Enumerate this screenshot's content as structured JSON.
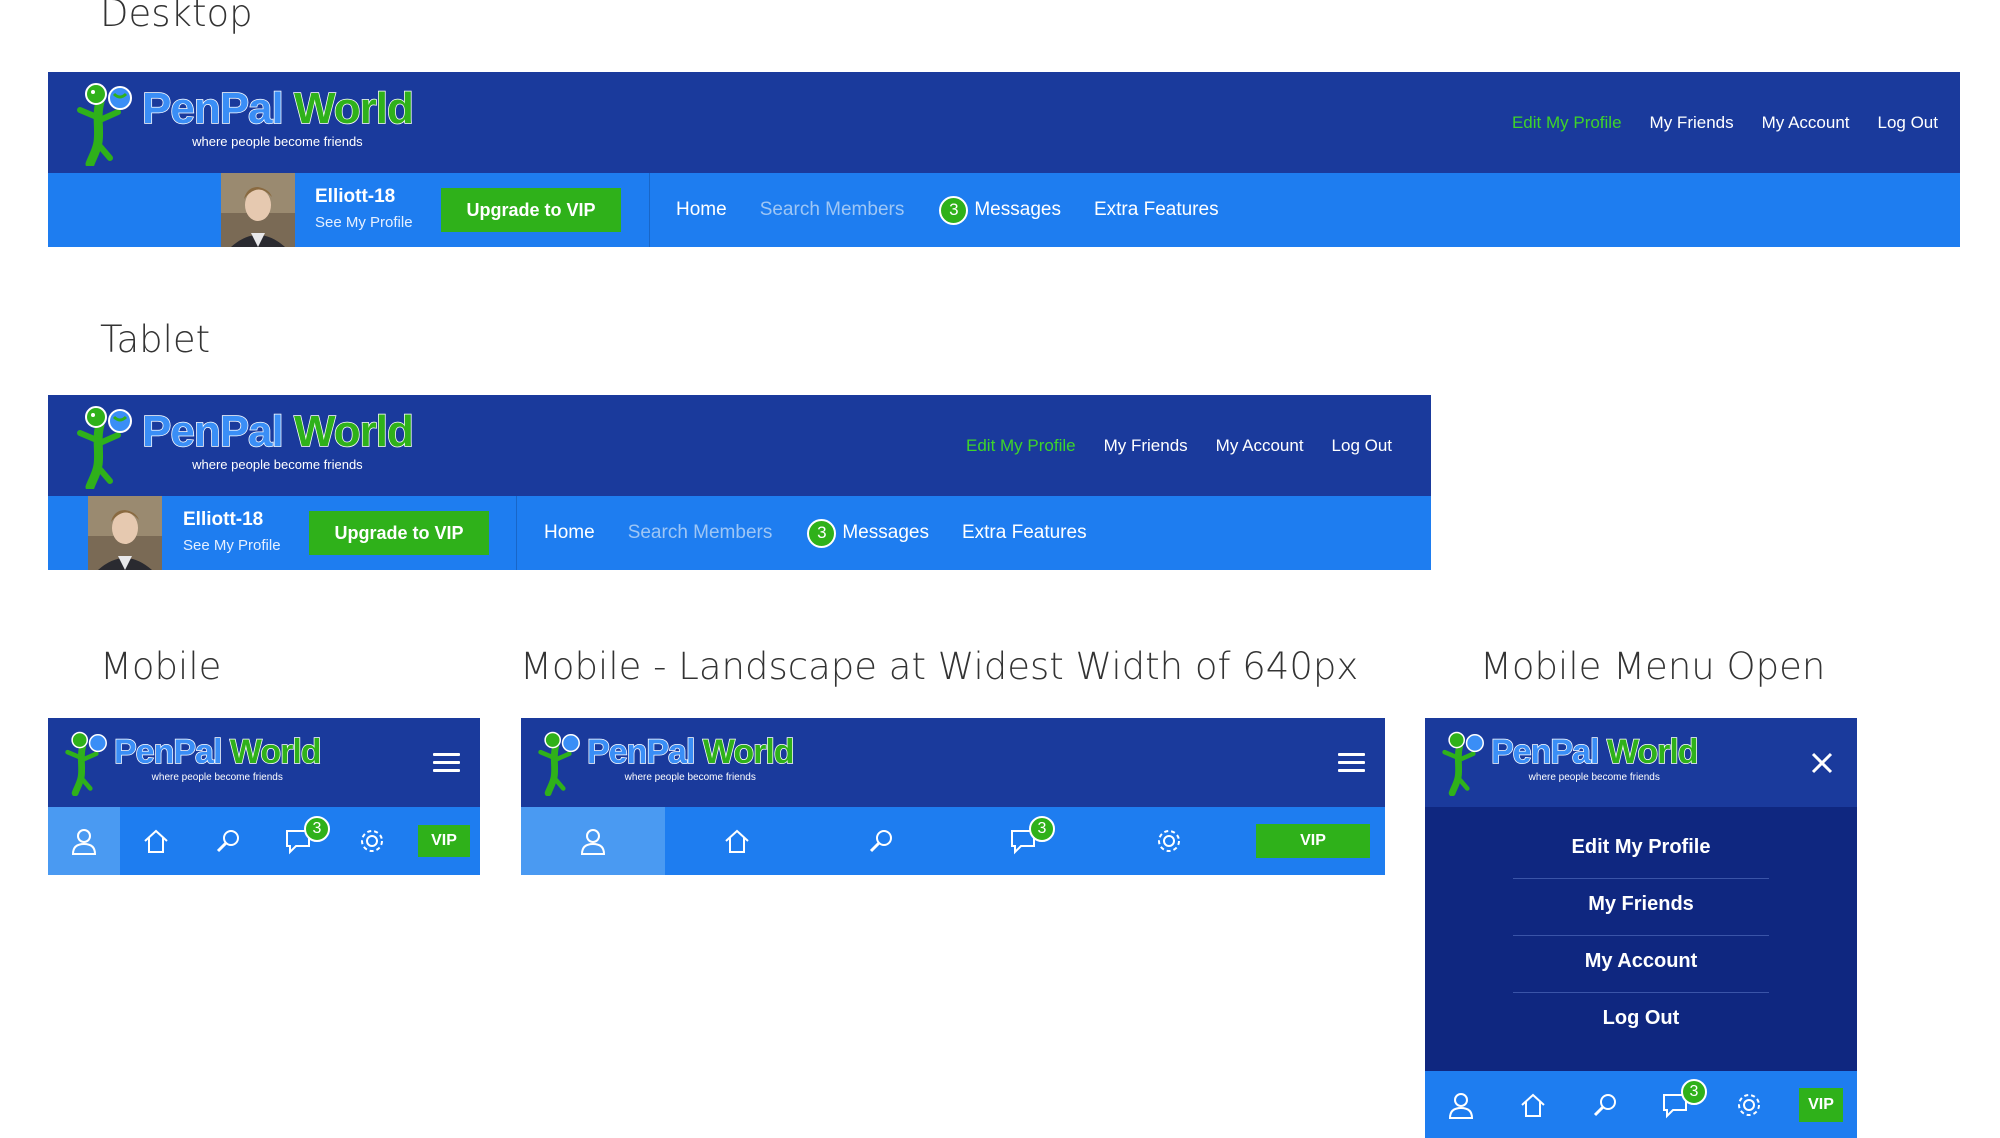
{
  "brand": {
    "name_part1": "PenPal",
    "name_part2": "World",
    "tagline": "where people become friends"
  },
  "sections": {
    "desktop": "Desktop",
    "tablet": "Tablet",
    "mobile": "Mobile",
    "mobile_landscape": "Mobile - Landscape at Widest Width of 640px",
    "mobile_menu_open": "Mobile Menu Open"
  },
  "top_links": [
    "Edit My Profile",
    "My Friends",
    "My Account",
    "Log Out"
  ],
  "user": {
    "name": "Elliott-18",
    "sub": "See My Profile"
  },
  "upgrade_label": "Upgrade to VIP",
  "nav": {
    "home": "Home",
    "search": "Search Members",
    "messages_count": "3",
    "messages": "Messages",
    "extra": "Extra Features"
  },
  "mobile": {
    "vip_label": "VIP",
    "message_count": "3",
    "icons": [
      "user-icon",
      "home-icon",
      "search-icon",
      "chat-icon",
      "gear-icon"
    ]
  },
  "mobile_menu": {
    "items": [
      "Edit My Profile",
      "My Friends",
      "My Account",
      "Log Out"
    ]
  },
  "colors": {
    "top_bar": "#1a3a9c",
    "sub_bar": "#1e7df0",
    "accent_green": "#2fb11a",
    "active_link": "#3ed42a",
    "menu_panel": "#0f2780"
  }
}
